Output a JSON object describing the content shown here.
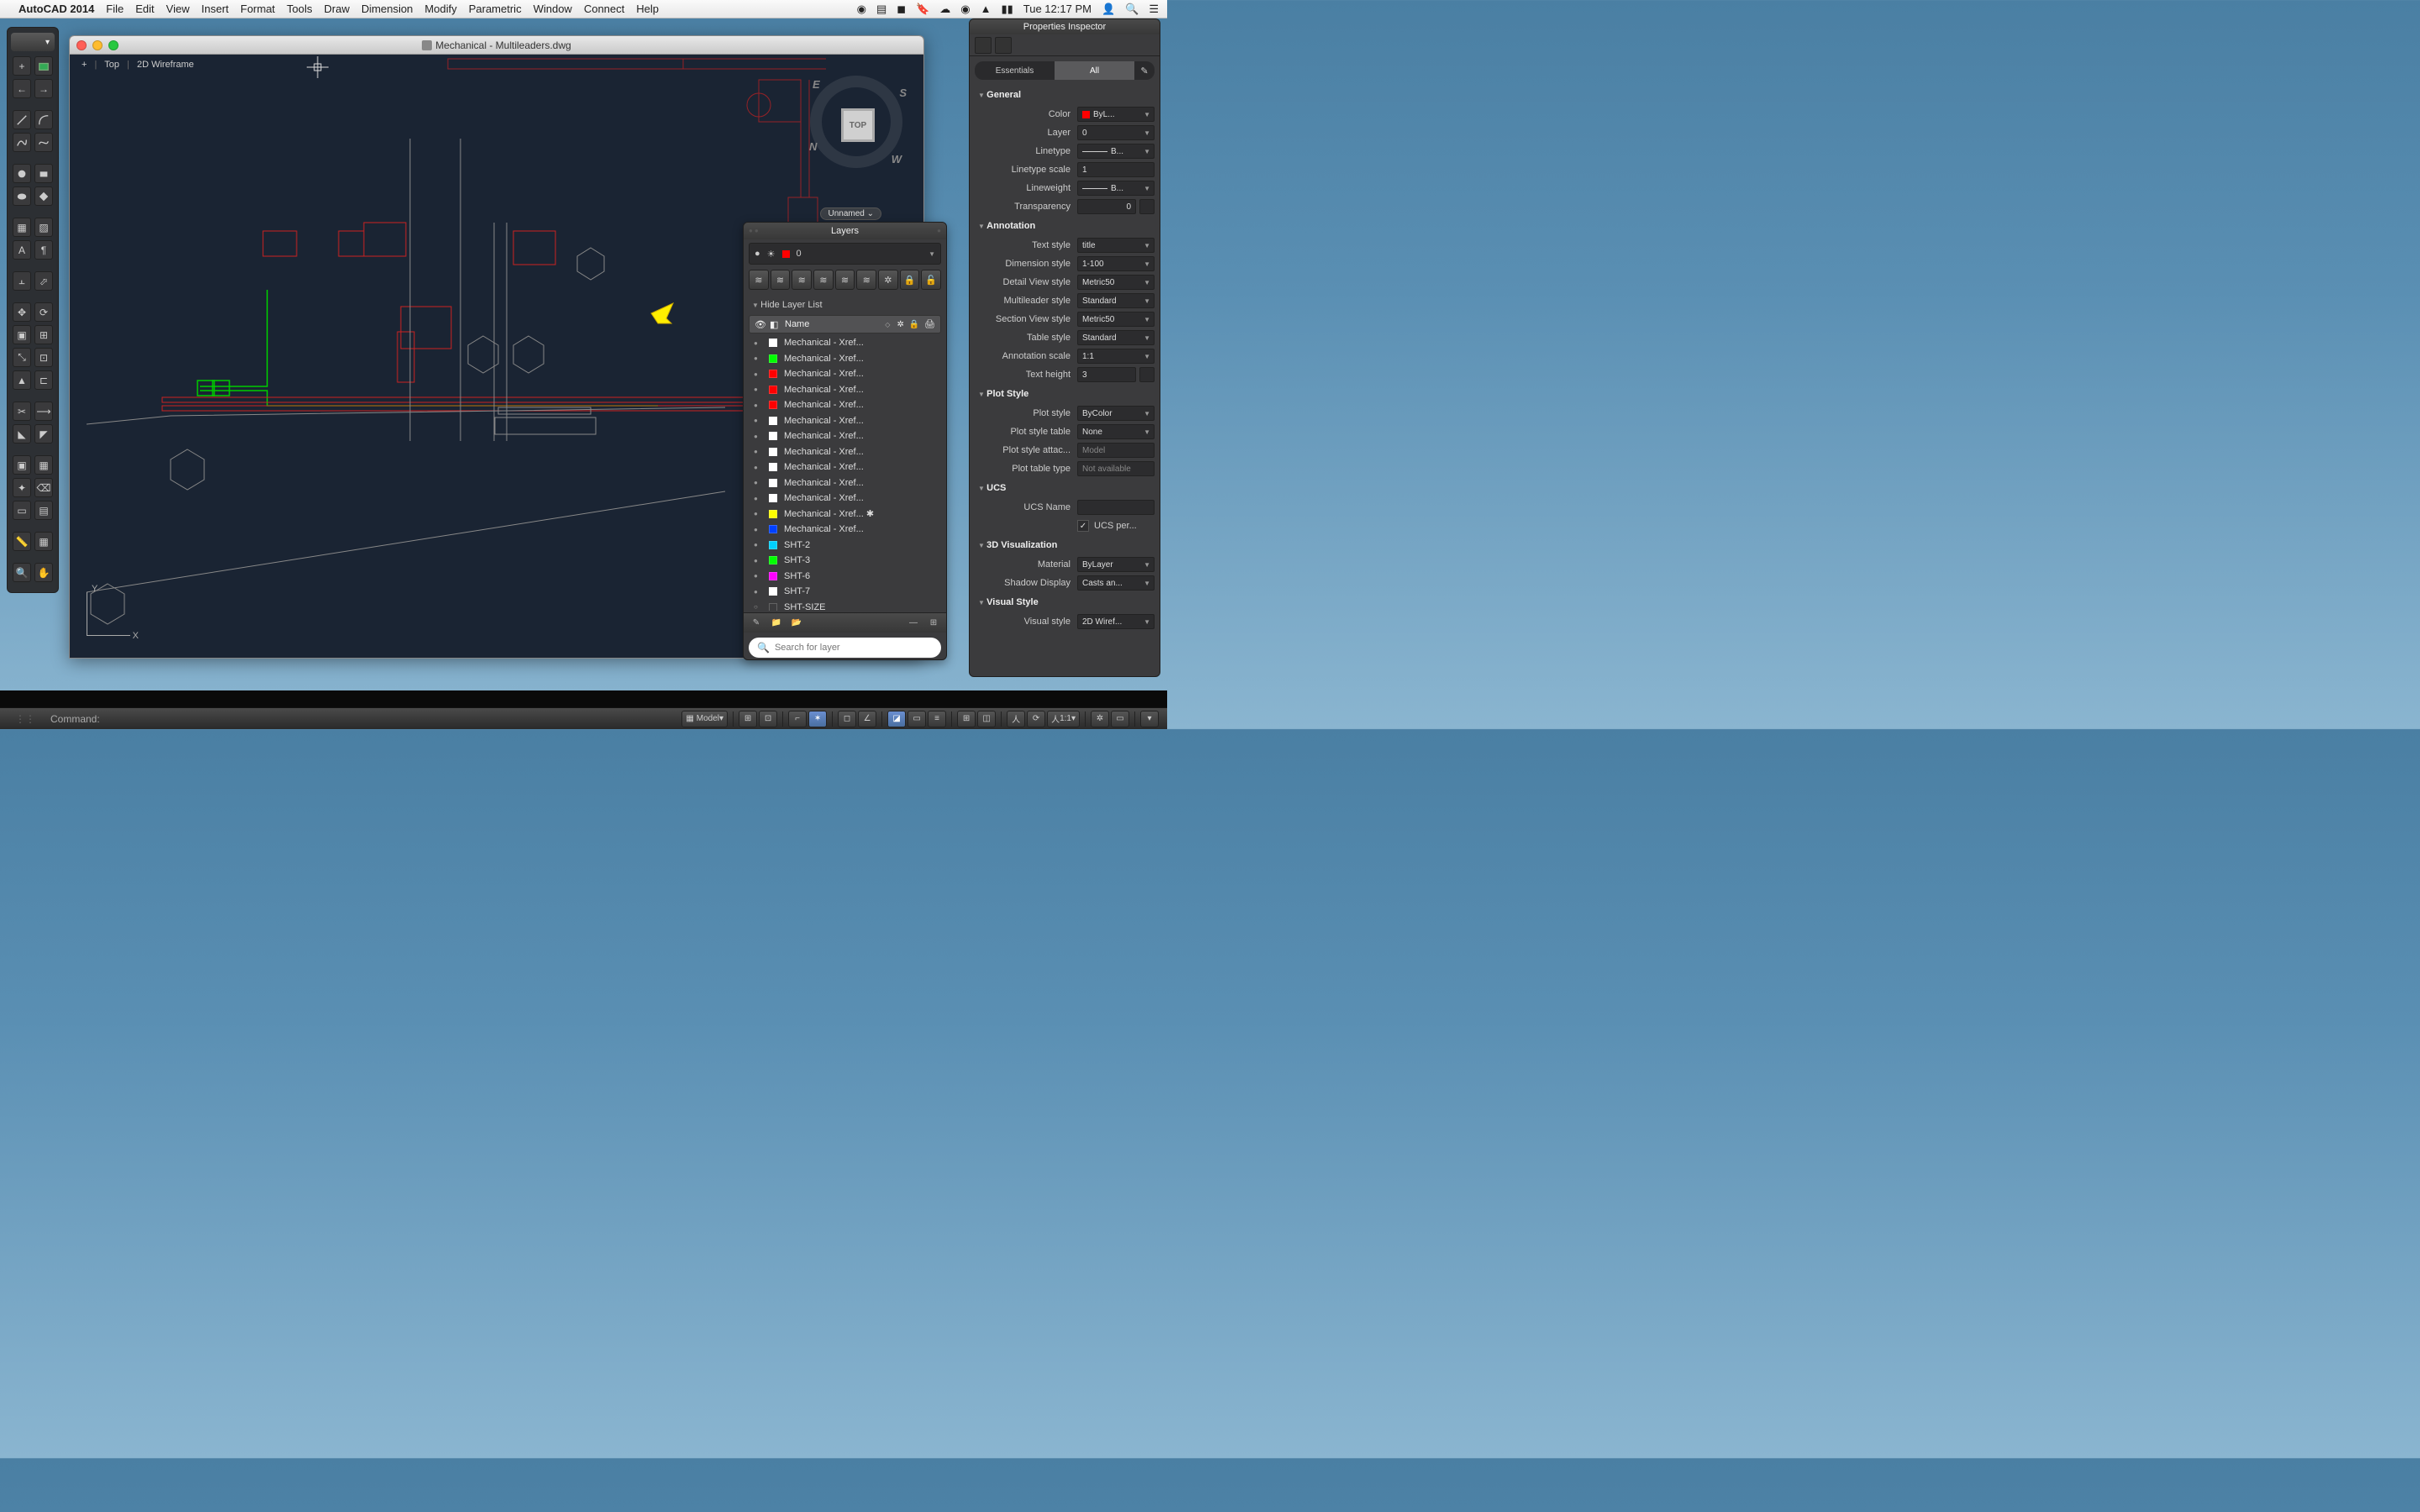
{
  "menubar": {
    "app_name": "AutoCAD 2014",
    "items": [
      "File",
      "Edit",
      "View",
      "Insert",
      "Format",
      "Tools",
      "Draw",
      "Dimension",
      "Modify",
      "Parametric",
      "Window",
      "Connect",
      "Help"
    ],
    "right": {
      "time": "Tue 12:17 PM"
    }
  },
  "document": {
    "title": "Mechanical - Multileaders.dwg",
    "view_label_1": "Top",
    "view_label_2": "2D Wireframe",
    "viewcube_face": "TOP",
    "unnamed_label": "Unnamed",
    "ucs_x": "X",
    "ucs_y": "Y"
  },
  "layers_panel": {
    "title": "Layers",
    "current_layer": "0",
    "hide_list_label": "Hide Layer List",
    "name_col": "Name",
    "search_placeholder": "Search for layer",
    "rows": [
      {
        "name": "Mechanical - Xref...",
        "color": "#ffffff",
        "on": true
      },
      {
        "name": "Mechanical - Xref...",
        "color": "#00ff00",
        "on": true
      },
      {
        "name": "Mechanical - Xref...",
        "color": "#ff0000",
        "on": true
      },
      {
        "name": "Mechanical - Xref...",
        "color": "#ff0000",
        "on": true
      },
      {
        "name": "Mechanical - Xref...",
        "color": "#ff0000",
        "on": true
      },
      {
        "name": "Mechanical - Xref...",
        "color": "#ffffff",
        "on": true
      },
      {
        "name": "Mechanical - Xref...",
        "color": "#ffffff",
        "on": true
      },
      {
        "name": "Mechanical - Xref...",
        "color": "#ffffff",
        "on": true
      },
      {
        "name": "Mechanical - Xref...",
        "color": "#ffffff",
        "on": true
      },
      {
        "name": "Mechanical - Xref...",
        "color": "#ffffff",
        "on": true
      },
      {
        "name": "Mechanical - Xref...",
        "color": "#ffffff",
        "on": true
      },
      {
        "name": "Mechanical - Xref... ✱",
        "color": "#ffff00",
        "on": true,
        "frozen": true
      },
      {
        "name": "Mechanical - Xref...",
        "color": "#0040ff",
        "on": true
      },
      {
        "name": "SHT-2",
        "color": "#00d0ff",
        "on": true
      },
      {
        "name": "SHT-3",
        "color": "#00ff00",
        "on": true
      },
      {
        "name": "SHT-6",
        "color": "#ff00ff",
        "on": true
      },
      {
        "name": "SHT-7",
        "color": "#ffffff",
        "on": true
      },
      {
        "name": "SHT-SIZE",
        "color": "transparent",
        "on": false
      }
    ]
  },
  "properties": {
    "title": "Properties Inspector",
    "tab_essentials": "Essentials",
    "tab_all": "All",
    "sections": {
      "general": "General",
      "annotation": "Annotation",
      "plot_style": "Plot Style",
      "ucs": "UCS",
      "viz3d": "3D Visualization",
      "visual_style": "Visual Style"
    },
    "rows": {
      "color_label": "Color",
      "color_value": "ByL...",
      "layer_label": "Layer",
      "layer_value": "0",
      "linetype_label": "Linetype",
      "linetype_value": "B...",
      "linetype_scale_label": "Linetype scale",
      "linetype_scale_value": "1",
      "lineweight_label": "Lineweight",
      "lineweight_value": "B...",
      "transparency_label": "Transparency",
      "transparency_value": "0",
      "text_style_label": "Text style",
      "text_style_value": "title",
      "dimension_style_label": "Dimension style",
      "dimension_style_value": "1-100",
      "detail_view_label": "Detail View style",
      "detail_view_value": "Metric50",
      "multileader_label": "Multileader style",
      "multileader_value": "Standard",
      "section_view_label": "Section View style",
      "section_view_value": "Metric50",
      "table_style_label": "Table style",
      "table_style_value": "Standard",
      "annotation_scale_label": "Annotation scale",
      "annotation_scale_value": "1:1",
      "text_height_label": "Text height",
      "text_height_value": "3",
      "plot_style_label": "Plot style",
      "plot_style_value": "ByColor",
      "plot_style_table_label": "Plot style table",
      "plot_style_table_value": "None",
      "plot_style_attach_label": "Plot style attac...",
      "plot_style_attach_value": "Model",
      "plot_table_type_label": "Plot table type",
      "plot_table_type_value": "Not available",
      "ucs_name_label": "UCS Name",
      "ucs_name_value": "",
      "ucs_per_label": "UCS per...",
      "material_label": "Material",
      "material_value": "ByLayer",
      "shadow_label": "Shadow Display",
      "shadow_value": "Casts an...",
      "visual_style_label": "Visual style",
      "visual_style_value": "2D Wiref..."
    }
  },
  "cmd": {
    "label": "Command:",
    "model_label": "Model",
    "scale_label": "1:1"
  }
}
